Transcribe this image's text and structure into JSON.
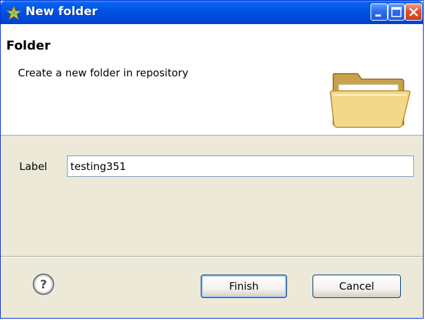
{
  "window": {
    "title": "New folder",
    "icon": "new-folder-star-icon"
  },
  "header": {
    "title": "Folder",
    "description": "Create a new folder in repository",
    "icon": "folder-open-icon"
  },
  "form": {
    "label_text": "Label",
    "label_value": "testing351"
  },
  "buttons": {
    "finish": "Finish",
    "cancel": "Cancel",
    "help_icon": "help-icon"
  },
  "colors": {
    "titlebar": "#0055e5",
    "dialog_bg": "#ece9d8",
    "close_button": "#e0502c"
  }
}
